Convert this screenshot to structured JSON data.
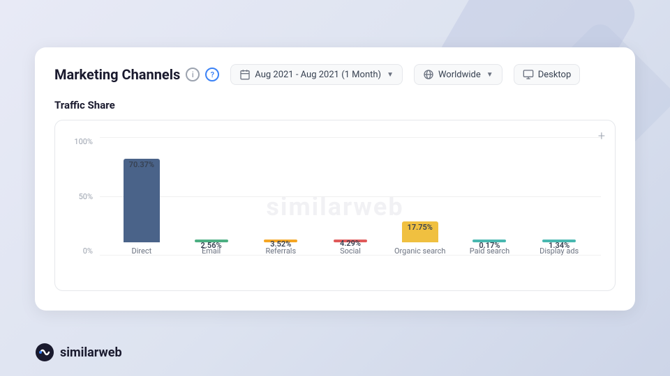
{
  "page": {
    "title": "Marketing Channels",
    "section_title": "Traffic Share",
    "brand": "similarweb"
  },
  "header": {
    "info_icon": "i",
    "help_icon": "?",
    "date_filter": "Aug 2021 - Aug 2021 (1 Month)",
    "region_filter": "Worldwide",
    "device_filter": "Desktop"
  },
  "chart": {
    "plus_icon": "+",
    "watermark": "similarweb",
    "y_labels": [
      "100%",
      "50%",
      "0%"
    ],
    "bars": [
      {
        "label": "Direct",
        "value": "70.37%",
        "color": "#4a6389",
        "height_pct": 70.37,
        "type": "bar"
      },
      {
        "label": "Email",
        "value": "2.56%",
        "color": "#4caf82",
        "height_pct": 2.56,
        "type": "thin"
      },
      {
        "label": "Referrals",
        "value": "3.52%",
        "color": "#f5a623",
        "height_pct": 3.52,
        "type": "thin"
      },
      {
        "label": "Social",
        "value": "4.29%",
        "color": "#e05a5a",
        "height_pct": 4.29,
        "type": "thin"
      },
      {
        "label": "Organic search",
        "value": "17.75%",
        "color": "#f0c040",
        "height_pct": 17.75,
        "type": "bar_wide"
      },
      {
        "label": "Paid search",
        "value": "0.17%",
        "color": "#48b8b0",
        "height_pct": 0.17,
        "type": "thin"
      },
      {
        "label": "Display ads",
        "value": "1.34%",
        "color": "#48b8b0",
        "height_pct": 1.34,
        "type": "thin"
      }
    ]
  },
  "tooltip": {
    "value": "17.7590",
    "label": "Organic search"
  }
}
